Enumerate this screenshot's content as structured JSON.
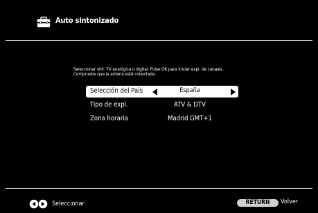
{
  "header": {
    "title": "Auto sintonizado",
    "icon": "toolbox-icon"
  },
  "instructions": [
    "Seleccionar sint. TV analógica o digital. Pulse OK para iniciar expl. de canales.",
    "Compruebe que la antena esté conectada."
  ],
  "settings": [
    {
      "label": "Selección del País",
      "value": "España",
      "selected": true
    },
    {
      "label": "Tipo de expl.",
      "value": "ATV & DTV",
      "selected": false
    },
    {
      "label": "Zona horaria",
      "value": "Madrid GMT+1",
      "selected": false
    }
  ],
  "footer": {
    "nav_icon": "left-right-arrows-icon",
    "select_label": "Seleccionar",
    "return_key": "RETURN",
    "back_label": "Volver"
  },
  "colors": {
    "background": "#000000",
    "text": "#ffffff",
    "highlight": "#ffffff",
    "divider": "#cfcfcf"
  }
}
